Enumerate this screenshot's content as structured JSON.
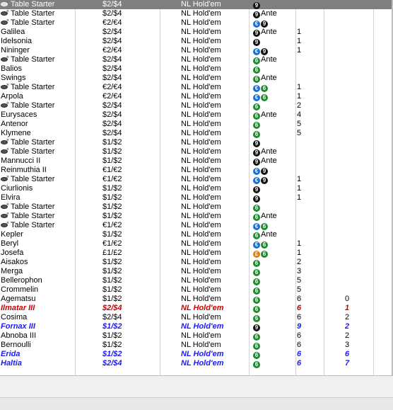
{
  "rows": [
    {
      "name": "Table Starter",
      "table_starter": true,
      "stakes": "$2/$4",
      "game": "NL Hold'em",
      "badges": [
        "nine"
      ],
      "ante": "",
      "players": "",
      "waiting": "",
      "style": "selected"
    },
    {
      "name": "Table Starter",
      "table_starter": true,
      "stakes": "$2/$4",
      "game": "NL Hold'em",
      "badges": [
        "nine"
      ],
      "ante": "Ante",
      "players": "",
      "waiting": "",
      "style": ""
    },
    {
      "name": "Table Starter",
      "table_starter": true,
      "stakes": "€2/€4",
      "game": "NL Hold'em",
      "badges": [
        "euro",
        "nine"
      ],
      "ante": "",
      "players": "",
      "waiting": "",
      "style": ""
    },
    {
      "name": "Galilea",
      "table_starter": false,
      "stakes": "$2/$4",
      "game": "NL Hold'em",
      "badges": [
        "nine"
      ],
      "ante": "Ante",
      "players": "1",
      "waiting": "",
      "style": ""
    },
    {
      "name": "Idelsonia",
      "table_starter": false,
      "stakes": "$2/$4",
      "game": "NL Hold'em",
      "badges": [
        "nine"
      ],
      "ante": "",
      "players": "1",
      "waiting": "",
      "style": ""
    },
    {
      "name": "Nininger",
      "table_starter": false,
      "stakes": "€2/€4",
      "game": "NL Hold'em",
      "badges": [
        "euro",
        "nine"
      ],
      "ante": "",
      "players": "1",
      "waiting": "",
      "style": ""
    },
    {
      "name": "Table Starter",
      "table_starter": true,
      "stakes": "$2/$4",
      "game": "NL Hold'em",
      "badges": [
        "six"
      ],
      "ante": "Ante",
      "players": "",
      "waiting": "",
      "style": ""
    },
    {
      "name": "Balios",
      "table_starter": false,
      "stakes": "$2/$4",
      "game": "NL Hold'em",
      "badges": [
        "six"
      ],
      "ante": "",
      "players": "",
      "waiting": "",
      "style": ""
    },
    {
      "name": "Swings",
      "table_starter": false,
      "stakes": "$2/$4",
      "game": "NL Hold'em",
      "badges": [
        "six"
      ],
      "ante": "Ante",
      "players": "",
      "waiting": "",
      "style": ""
    },
    {
      "name": "Table Starter",
      "table_starter": true,
      "stakes": "€2/€4",
      "game": "NL Hold'em",
      "badges": [
        "euro",
        "six"
      ],
      "ante": "",
      "players": "1",
      "waiting": "",
      "style": ""
    },
    {
      "name": "Arpola",
      "table_starter": false,
      "stakes": "€2/€4",
      "game": "NL Hold'em",
      "badges": [
        "euro",
        "six"
      ],
      "ante": "",
      "players": "1",
      "waiting": "",
      "style": ""
    },
    {
      "name": "Table Starter",
      "table_starter": true,
      "stakes": "$2/$4",
      "game": "NL Hold'em",
      "badges": [
        "six"
      ],
      "ante": "",
      "players": "2",
      "waiting": "",
      "style": ""
    },
    {
      "name": "Eurysaces",
      "table_starter": false,
      "stakes": "$2/$4",
      "game": "NL Hold'em",
      "badges": [
        "six"
      ],
      "ante": "Ante",
      "players": "4",
      "waiting": "",
      "style": ""
    },
    {
      "name": "Antenor",
      "table_starter": false,
      "stakes": "$2/$4",
      "game": "NL Hold'em",
      "badges": [
        "six"
      ],
      "ante": "",
      "players": "5",
      "waiting": "",
      "style": ""
    },
    {
      "name": "Klymene",
      "table_starter": false,
      "stakes": "$2/$4",
      "game": "NL Hold'em",
      "badges": [
        "six"
      ],
      "ante": "",
      "players": "5",
      "waiting": "",
      "style": ""
    },
    {
      "name": "Table Starter",
      "table_starter": true,
      "stakes": "$1/$2",
      "game": "NL Hold'em",
      "badges": [
        "nine"
      ],
      "ante": "",
      "players": "",
      "waiting": "",
      "style": ""
    },
    {
      "name": "Table Starter",
      "table_starter": true,
      "stakes": "$1/$2",
      "game": "NL Hold'em",
      "badges": [
        "nine"
      ],
      "ante": "Ante",
      "players": "",
      "waiting": "",
      "style": ""
    },
    {
      "name": "Mannucci II",
      "table_starter": false,
      "stakes": "$1/$2",
      "game": "NL Hold'em",
      "badges": [
        "nine"
      ],
      "ante": "Ante",
      "players": "",
      "waiting": "",
      "style": ""
    },
    {
      "name": "Reinmuthia II",
      "table_starter": false,
      "stakes": "€1/€2",
      "game": "NL Hold'em",
      "badges": [
        "euro",
        "nine"
      ],
      "ante": "",
      "players": "",
      "waiting": "",
      "style": ""
    },
    {
      "name": "Table Starter",
      "table_starter": true,
      "stakes": "€1/€2",
      "game": "NL Hold'em",
      "badges": [
        "euro",
        "nine"
      ],
      "ante": "",
      "players": "1",
      "waiting": "",
      "style": ""
    },
    {
      "name": "Ciurlionis",
      "table_starter": false,
      "stakes": "$1/$2",
      "game": "NL Hold'em",
      "badges": [
        "nine"
      ],
      "ante": "",
      "players": "1",
      "waiting": "",
      "style": ""
    },
    {
      "name": "Elvira",
      "table_starter": false,
      "stakes": "$1/$2",
      "game": "NL Hold'em",
      "badges": [
        "nine"
      ],
      "ante": "",
      "players": "1",
      "waiting": "",
      "style": ""
    },
    {
      "name": "Table Starter",
      "table_starter": true,
      "stakes": "$1/$2",
      "game": "NL Hold'em",
      "badges": [
        "six"
      ],
      "ante": "",
      "players": "",
      "waiting": "",
      "style": ""
    },
    {
      "name": "Table Starter",
      "table_starter": true,
      "stakes": "$1/$2",
      "game": "NL Hold'em",
      "badges": [
        "six"
      ],
      "ante": "Ante",
      "players": "",
      "waiting": "",
      "style": ""
    },
    {
      "name": "Table Starter",
      "table_starter": true,
      "stakes": "€1/€2",
      "game": "NL Hold'em",
      "badges": [
        "euro",
        "six"
      ],
      "ante": "",
      "players": "",
      "waiting": "",
      "style": ""
    },
    {
      "name": "Kepler",
      "table_starter": false,
      "stakes": "$1/$2",
      "game": "NL Hold'em",
      "badges": [
        "six"
      ],
      "ante": "Ante",
      "players": "",
      "waiting": "",
      "style": ""
    },
    {
      "name": "Beryl",
      "table_starter": false,
      "stakes": "€1/€2",
      "game": "NL Hold'em",
      "badges": [
        "euro",
        "six"
      ],
      "ante": "",
      "players": "1",
      "waiting": "",
      "style": ""
    },
    {
      "name": "Josefa",
      "table_starter": false,
      "stakes": "£1/£2",
      "game": "NL Hold'em",
      "badges": [
        "pound",
        "six"
      ],
      "ante": "",
      "players": "1",
      "waiting": "",
      "style": ""
    },
    {
      "name": "Aisakos",
      "table_starter": false,
      "stakes": "$1/$2",
      "game": "NL Hold'em",
      "badges": [
        "six"
      ],
      "ante": "",
      "players": "2",
      "waiting": "",
      "style": ""
    },
    {
      "name": "Merga",
      "table_starter": false,
      "stakes": "$1/$2",
      "game": "NL Hold'em",
      "badges": [
        "six"
      ],
      "ante": "",
      "players": "3",
      "waiting": "",
      "style": ""
    },
    {
      "name": "Bellerophon",
      "table_starter": false,
      "stakes": "$1/$2",
      "game": "NL Hold'em",
      "badges": [
        "six"
      ],
      "ante": "",
      "players": "5",
      "waiting": "",
      "style": ""
    },
    {
      "name": "Crommelin",
      "table_starter": false,
      "stakes": "$1/$2",
      "game": "NL Hold'em",
      "badges": [
        "six"
      ],
      "ante": "",
      "players": "5",
      "waiting": "",
      "style": ""
    },
    {
      "name": "Agematsu",
      "table_starter": false,
      "stakes": "$1/$2",
      "game": "NL Hold'em",
      "badges": [
        "six"
      ],
      "ante": "",
      "players": "6",
      "waiting": "0",
      "style": ""
    },
    {
      "name": "Ilmatar III",
      "table_starter": false,
      "stakes": "$2/$4",
      "game": "NL Hold'em",
      "badges": [
        "six"
      ],
      "ante": "",
      "players": "6",
      "waiting": "1",
      "style": "red"
    },
    {
      "name": "Cosima",
      "table_starter": false,
      "stakes": "$2/$4",
      "game": "NL Hold'em",
      "badges": [
        "six"
      ],
      "ante": "",
      "players": "6",
      "waiting": "2",
      "style": ""
    },
    {
      "name": "Fornax III",
      "table_starter": false,
      "stakes": "$1/$2",
      "game": "NL Hold'em",
      "badges": [
        "nine"
      ],
      "ante": "",
      "players": "9",
      "waiting": "2",
      "style": "blue"
    },
    {
      "name": "Abnoba III",
      "table_starter": false,
      "stakes": "$1/$2",
      "game": "NL Hold'em",
      "badges": [
        "six"
      ],
      "ante": "",
      "players": "6",
      "waiting": "2",
      "style": ""
    },
    {
      "name": "Bernoulli",
      "table_starter": false,
      "stakes": "$1/$2",
      "game": "NL Hold'em",
      "badges": [
        "six"
      ],
      "ante": "",
      "players": "6",
      "waiting": "3",
      "style": ""
    },
    {
      "name": "Erida",
      "table_starter": false,
      "stakes": "$1/$2",
      "game": "NL Hold'em",
      "badges": [
        "six"
      ],
      "ante": "",
      "players": "6",
      "waiting": "6",
      "style": "blue"
    },
    {
      "name": "Haltia",
      "table_starter": false,
      "stakes": "$2/$4",
      "game": "NL Hold'em",
      "badges": [
        "six"
      ],
      "ante": "",
      "players": "6",
      "waiting": "7",
      "style": "blue"
    }
  ],
  "badge_glyphs": {
    "nine": "9",
    "six": "6",
    "euro": "€",
    "pound": "£"
  },
  "icons": {
    "table_starter": "table-starter-icon"
  },
  "colors": {
    "selected_row": "#7f7f7f",
    "highlight_red": "#cc0000",
    "highlight_blue": "#1a1aff",
    "six_max_badge": "#1f8a2e",
    "nine_max_badge": "#111111",
    "euro_badge": "#1a6fd6",
    "pound_badge": "#e07d10"
  }
}
